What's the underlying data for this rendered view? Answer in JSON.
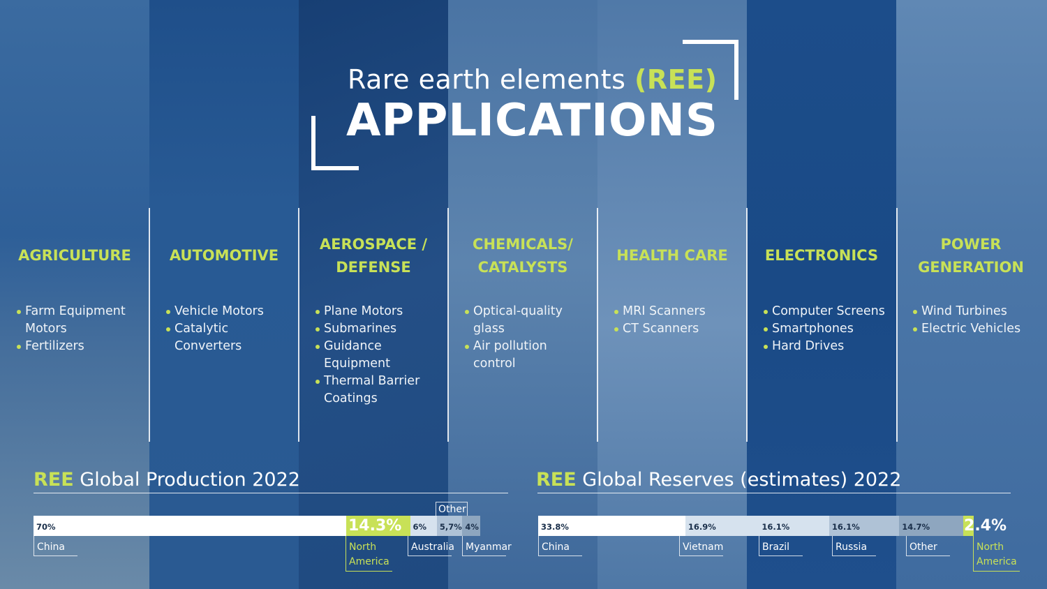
{
  "header": {
    "subtitle_part1": "Rare earth elements",
    "subtitle_part2": "(REE)",
    "title": "APPLICATIONS"
  },
  "categories": [
    {
      "title": "AGRICULTURE",
      "items": [
        "Farm Equipment Motors",
        "Fertilizers"
      ]
    },
    {
      "title": "AUTOMOTIVE",
      "items": [
        "Vehicle Motors",
        "Catalytic Converters"
      ]
    },
    {
      "title": "AEROSPACE / DEFENSE",
      "items": [
        "Plane Motors",
        "Submarines",
        "Guidance Equipment",
        "Thermal Barrier Coatings"
      ]
    },
    {
      "title": "CHEMICALS/ CATALYSTS",
      "items": [
        "Optical-quality glass",
        "Air pollution control"
      ]
    },
    {
      "title": "HEALTH CARE",
      "items": [
        "MRI Scanners",
        "CT Scanners"
      ]
    },
    {
      "title": "ELECTRONICS",
      "items": [
        "Computer Screens",
        "Smartphones",
        "Hard Drives"
      ]
    },
    {
      "title": "POWER GENERATION",
      "items": [
        "Wind Turbines",
        "Electric Vehicles"
      ]
    }
  ],
  "colors": {
    "accent": "#c8e157",
    "background": "#2a5a92",
    "bar_white": "#ffffff",
    "bar_light": "#d6e2ee",
    "bar_mid": "#afc2d6",
    "bar_dark": "#8ea6bf"
  },
  "chart_data": [
    {
      "type": "bar",
      "stacked": "horizontal-100",
      "title_prefix": "REE",
      "title_rest": "Global Production 2022",
      "categories": [
        "China",
        "North America",
        "Australia",
        "Other",
        "Myanmar"
      ],
      "values": [
        70,
        14.3,
        6,
        5.7,
        4
      ],
      "labels": [
        "70%",
        "14.3%",
        "6%",
        "5,7%",
        "4%"
      ],
      "highlight": "North America"
    },
    {
      "type": "bar",
      "stacked": "horizontal-100",
      "title_prefix": "REE",
      "title_rest": "Global Reserves (estimates) 2022",
      "categories": [
        "China",
        "Vietnam",
        "Brazil",
        "Russia",
        "Other",
        "North America"
      ],
      "values": [
        33.8,
        16.9,
        16.1,
        16.1,
        14.7,
        2.4
      ],
      "labels": [
        "33.8%",
        "16.9%",
        "16.1%",
        "16.1%",
        "14.7%",
        "2.4%"
      ],
      "highlight": "North America"
    }
  ]
}
